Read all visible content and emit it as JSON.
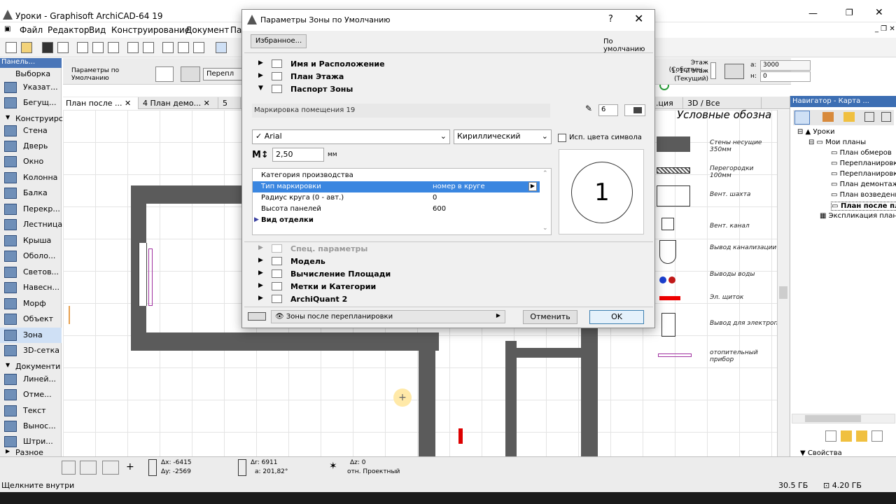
{
  "window": {
    "title": "Уроки - Graphisoft ArchiCAD-64 19"
  },
  "menu": [
    "Файл",
    "Редактор",
    "Вид",
    "Конструирование",
    "Документ",
    "Па"
  ],
  "infobox": {
    "params_label": "Параметры по Умолчанию",
    "floor_info": "Этаж (Собствен...",
    "floor_name": "1. 1-й этаж (Текущий)",
    "field_a_label": "a:",
    "field_a": "3000",
    "field_b_label": "н:",
    "field_b": "0",
    "perep": "Перепл"
  },
  "toolbox": {
    "header": "Панель...",
    "select": "Выборка",
    "items": [
      {
        "label": "Указат..."
      },
      {
        "label": "Бегущ..."
      },
      {
        "label": "Конструирс"
      },
      {
        "label": "Стена"
      },
      {
        "label": "Дверь"
      },
      {
        "label": "Окно"
      },
      {
        "label": "Колонна"
      },
      {
        "label": "Балка"
      },
      {
        "label": "Перекр..."
      },
      {
        "label": "Лестница"
      },
      {
        "label": "Крыша"
      },
      {
        "label": "Оболо..."
      },
      {
        "label": "Светов..."
      },
      {
        "label": "Навесн..."
      },
      {
        "label": "Морф"
      },
      {
        "label": "Объект"
      },
      {
        "label": "Зона"
      },
      {
        "label": "3D-сетка"
      },
      {
        "label": "Документи"
      },
      {
        "label": "Линей..."
      },
      {
        "label": "Отме..."
      },
      {
        "label": "Текст"
      },
      {
        "label": "Вынос..."
      },
      {
        "label": "Штри..."
      },
      {
        "label": "Разное"
      }
    ]
  },
  "tabs": [
    "План после ...",
    "4 План демо...",
    "5",
    "...ция",
    "3D / Все"
  ],
  "legend": {
    "title": "Условные обозна",
    "items": [
      "Стены несущие 350мм",
      "Перегородки 100мм",
      "Вент. шахта",
      "Вент. канал",
      "Вывод канализации",
      "Выводы воды",
      "Эл. щиток",
      "Вывод для электропли",
      "отопительный прибор"
    ]
  },
  "navigator": {
    "header": "Навигатор - Карта ...",
    "tree": [
      "Уроки",
      "Мои планы",
      "План обмеров",
      "Перепланировк",
      "Перепланировк",
      "План демонтаж",
      "План возведени",
      "План после пл",
      "Экспликация плани"
    ],
    "properties": "Свойства"
  },
  "status": {
    "dx": "Δx: -6415",
    "dy": "Δy: -2569",
    "dr": "Δr: 6911",
    "da": "a: 201,82°",
    "dz": "Δz: 0",
    "proj": "отн. Проектный"
  },
  "bottom": {
    "hint": "Щелкните внутри",
    "disk": "30.5 ГБ",
    "ram": "4.20 ГБ"
  },
  "dialog": {
    "title": "Параметры Зоны по Умолчанию",
    "help": "?",
    "close": "✕",
    "favorites": "Избранное...",
    "default_label": "По умолчанию",
    "sections_top": [
      {
        "label": "Имя и Расположение",
        "open": false
      },
      {
        "label": "План Этажа",
        "open": false
      },
      {
        "label": "Паспорт Зоны",
        "open": true
      }
    ],
    "marking_label": "Маркировка помещения 19",
    "pen_value": "6",
    "font": "Arial",
    "charset": "Кириллический",
    "use_symbol_color": "Исп. цвета символа",
    "size_value": "2,50",
    "size_unit": "мм",
    "props": [
      {
        "k": "Категория производства",
        "v": ""
      },
      {
        "k": "Тип маркировки",
        "v": "номер в круге"
      },
      {
        "k": "Радиус круга (0 - авт.)",
        "v": "0"
      },
      {
        "k": "Высота панелей",
        "v": "600"
      }
    ],
    "finish": "Вид отделки",
    "preview_number": "1",
    "sections_bottom": [
      {
        "label": "Спец. параметры",
        "disabled": true
      },
      {
        "label": "Модель"
      },
      {
        "label": "Вычисление Площади"
      },
      {
        "label": "Метки и Категории"
      },
      {
        "label": "ArchiQuant 2"
      }
    ],
    "layer": "Зоны после перепланировки",
    "cancel": "Отменить",
    "ok": "OK"
  }
}
